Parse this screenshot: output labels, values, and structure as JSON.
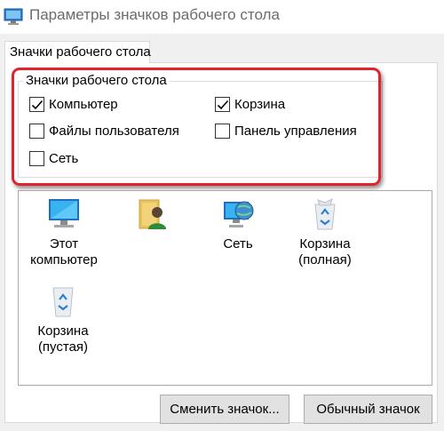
{
  "window": {
    "title": "Параметры значков рабочего стола",
    "app_icon": "desktop-icons-settings-icon"
  },
  "tabs": [
    {
      "label": "Значки рабочего стола",
      "selected": true
    }
  ],
  "group": {
    "title": "Значки рабочего стола",
    "checkboxes": [
      {
        "label": "Компьютер",
        "checked": true
      },
      {
        "label": "Корзина",
        "checked": true
      },
      {
        "label": "Файлы пользователя",
        "checked": false
      },
      {
        "label": "Панель управления",
        "checked": false
      },
      {
        "label": "Сеть",
        "checked": false
      }
    ]
  },
  "icons": [
    {
      "label": "Этот компьютер",
      "icon": "computer-monitor-icon"
    },
    {
      "label": "",
      "icon": "user-folder-icon"
    },
    {
      "label": "Сеть",
      "icon": "network-globe-icon"
    },
    {
      "label": "Корзина (полная)",
      "icon": "recycle-bin-full-icon"
    },
    {
      "label": "Корзина (пустая)",
      "icon": "recycle-bin-empty-icon"
    }
  ],
  "buttons": {
    "change_icon": "Сменить значок...",
    "restore_default": "Обычный значок"
  },
  "colors": {
    "highlight_frame": "#e0232d",
    "checkmark": "#000000"
  }
}
